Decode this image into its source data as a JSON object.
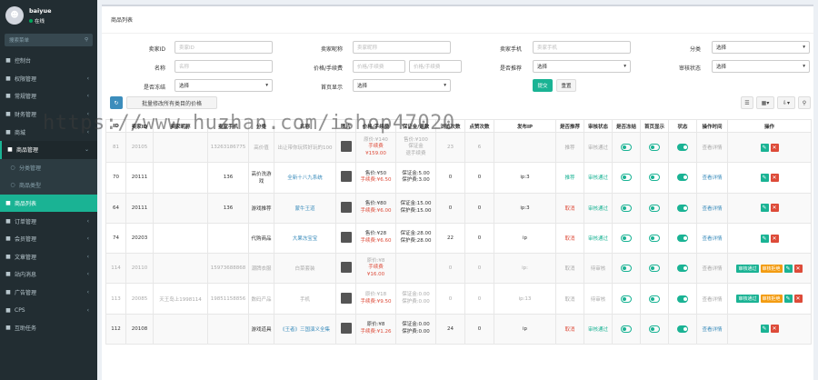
{
  "user": {
    "name": "baiyue",
    "status": "在线"
  },
  "sidebar": {
    "search_placeholder": "搜索菜单",
    "items": [
      {
        "icon": "dashboard-icon",
        "label": "控制台",
        "arrow": false,
        "state": ""
      },
      {
        "icon": "user-icon",
        "label": "权限管理",
        "arrow": true,
        "state": ""
      },
      {
        "icon": "gear-icon",
        "label": "常规管理",
        "arrow": true,
        "state": ""
      },
      {
        "icon": "money-icon",
        "label": "财务管理",
        "arrow": true,
        "state": ""
      },
      {
        "icon": "shop-icon",
        "label": "商城",
        "arrow": true,
        "state": ""
      },
      {
        "icon": "goods-icon",
        "label": "商品管理",
        "arrow": true,
        "state": "open"
      },
      {
        "icon": "circle-icon",
        "label": "分类管理",
        "arrow": false,
        "state": "sub"
      },
      {
        "icon": "circle-icon",
        "label": "商品类型",
        "arrow": false,
        "state": "sub"
      },
      {
        "icon": "list-icon",
        "label": "商品列表",
        "arrow": false,
        "state": "active"
      },
      {
        "icon": "order-icon",
        "label": "订单管理",
        "arrow": true,
        "state": ""
      },
      {
        "icon": "member-icon",
        "label": "会员管理",
        "arrow": true,
        "state": ""
      },
      {
        "icon": "doc-icon",
        "label": "文章管理",
        "arrow": true,
        "state": ""
      },
      {
        "icon": "site-icon",
        "label": "站内消息",
        "arrow": true,
        "state": ""
      },
      {
        "icon": "ad-icon",
        "label": "广告管理",
        "arrow": true,
        "state": ""
      },
      {
        "icon": "cps-icon",
        "label": "CPS",
        "arrow": true,
        "state": ""
      },
      {
        "icon": "task-icon",
        "label": "互助任务",
        "arrow": false,
        "state": ""
      }
    ]
  },
  "page": {
    "title": "商品列表"
  },
  "filters": {
    "seller_id": {
      "label": "卖家ID",
      "placeholder": "卖家ID"
    },
    "seller_name": {
      "label": "卖家昵称",
      "placeholder": "卖家昵称"
    },
    "seller_phone": {
      "label": "卖家手机",
      "placeholder": "卖家手机"
    },
    "category": {
      "label": "分类",
      "value": "选择"
    },
    "name": {
      "label": "名称",
      "placeholder": "名称"
    },
    "price_range": {
      "label": "价格/手续费",
      "from_placeholder": "价格/手续费",
      "to_placeholder": "价格/手续费"
    },
    "recommend": {
      "label": "是否推荐",
      "value": "选择"
    },
    "audit": {
      "label": "审核状态",
      "value": "选择"
    },
    "frozen": {
      "label": "是否冻结",
      "value": "选择"
    },
    "home_show": {
      "label": "首页显示",
      "value": "选择"
    },
    "submit_label": "提交",
    "reset_label": "重置"
  },
  "toolbar": {
    "batch_label": "批量修改所有类目的价格"
  },
  "table": {
    "headers": [
      "ID",
      "卖家ID",
      "卖家昵称",
      "卖家手机",
      "分类",
      "名称",
      "图片",
      "价格/手续费",
      "保证金/退款",
      "浏览次数",
      "点赞次数",
      "发布IP",
      "是否推荐",
      "审核状态",
      "是否冻结",
      "首页显示",
      "状态",
      "操作时间",
      "操作"
    ],
    "rows": [
      {
        "id": "81",
        "seller_id": "20105",
        "nick": "",
        "phone": "13263186775",
        "cat": "高价值",
        "name": "出让带你玩转好玩的100",
        "price": [
          "原价:¥140",
          "手续费",
          "¥159.00"
        ],
        "deposit": [
          "售价:¥100",
          "保证金",
          "退手续费"
        ],
        "views": "23",
        "likes": "6",
        "ip": "",
        "rec": "推荐",
        "audit": "审核通过",
        "freeze": false,
        "home": false,
        "status": true,
        "optime": "查看详情",
        "dim": true,
        "tags": []
      },
      {
        "id": "70",
        "seller_id": "20111",
        "nick": "",
        "phone": "136",
        "cat": "高价洗游戏",
        "name": "全新十八九系统",
        "price": [
          "售价:¥50",
          "手续费:¥6.50"
        ],
        "deposit": [
          "保证金:5.00",
          "保护费:3.00"
        ],
        "views": "0",
        "likes": "0",
        "ip": "ip:3",
        "rec": "推荐",
        "audit": "审核通过",
        "freeze": false,
        "home": false,
        "status": true,
        "optime": "查看详情",
        "dim": false,
        "tags": []
      },
      {
        "id": "64",
        "seller_id": "20111",
        "nick": "",
        "phone": "136",
        "cat": "游戏推荐",
        "name": "蒙牛王道",
        "price": [
          "售价:¥80",
          "手续费:¥6.00"
        ],
        "deposit": [
          "保证金:15.00",
          "保护费:15.00"
        ],
        "views": "0",
        "likes": "0",
        "ip": "ip:3",
        "rec": "取消",
        "audit": "审核通过",
        "freeze": false,
        "home": false,
        "status": true,
        "optime": "查看详情",
        "dim": false,
        "tags": []
      },
      {
        "id": "74",
        "seller_id": "20203",
        "nick": "",
        "phone": "",
        "cat": "代购商品",
        "name": "大果冻宝宝",
        "price": [
          "售价:¥28",
          "手续费:¥6.60"
        ],
        "deposit": [
          "保证金:28.00",
          "保护费:28.00"
        ],
        "views": "22",
        "likes": "0",
        "ip": "ip",
        "rec": "取消",
        "audit": "审核通过",
        "freeze": false,
        "home": false,
        "status": true,
        "optime": "查看详情",
        "dim": false,
        "tags": []
      },
      {
        "id": "114",
        "seller_id": "20110",
        "nick": "",
        "phone": "15973688868",
        "cat": "潮牌衣服",
        "name": "白菜套装",
        "price": [
          "原价:¥8",
          "手续费",
          "¥16.00"
        ],
        "deposit": [],
        "views": "0",
        "likes": "0",
        "ip": "ip:",
        "rec": "取消",
        "audit": "待审核",
        "freeze": false,
        "home": false,
        "status": true,
        "optime": "查看详情",
        "dim": true,
        "tags": [
          "审核通过",
          "审核拒绝"
        ]
      },
      {
        "id": "113",
        "seller_id": "20085",
        "nick": "天王岛上1998114",
        "phone": "19851158856",
        "cat": "数码产品",
        "name": "手机",
        "price": [
          "原价:¥18",
          "手续费:¥9.50"
        ],
        "deposit": [
          "保证金:0.00",
          "保护费:0.00"
        ],
        "views": "0",
        "likes": "0",
        "ip": "ip:13",
        "rec": "取消",
        "audit": "待审核",
        "freeze": false,
        "home": false,
        "status": true,
        "optime": "查看详情",
        "dim": true,
        "tags": [
          "审核通过",
          "审核拒绝"
        ]
      },
      {
        "id": "112",
        "seller_id": "20108",
        "nick": "",
        "phone": "",
        "cat": "游戏道具",
        "name": "《王者》三国演义全集",
        "price": [
          "原价:¥8",
          "手续费:¥1.26"
        ],
        "deposit": [
          "保证金:0.00",
          "保护费:0.00"
        ],
        "views": "24",
        "likes": "0",
        "ip": "ip",
        "rec": "取消",
        "audit": "审核通过",
        "freeze": false,
        "home": false,
        "status": true,
        "optime": "查看详情",
        "dim": false,
        "tags": []
      }
    ]
  },
  "watermark": "https://www.huzhan.com/ishop47020"
}
